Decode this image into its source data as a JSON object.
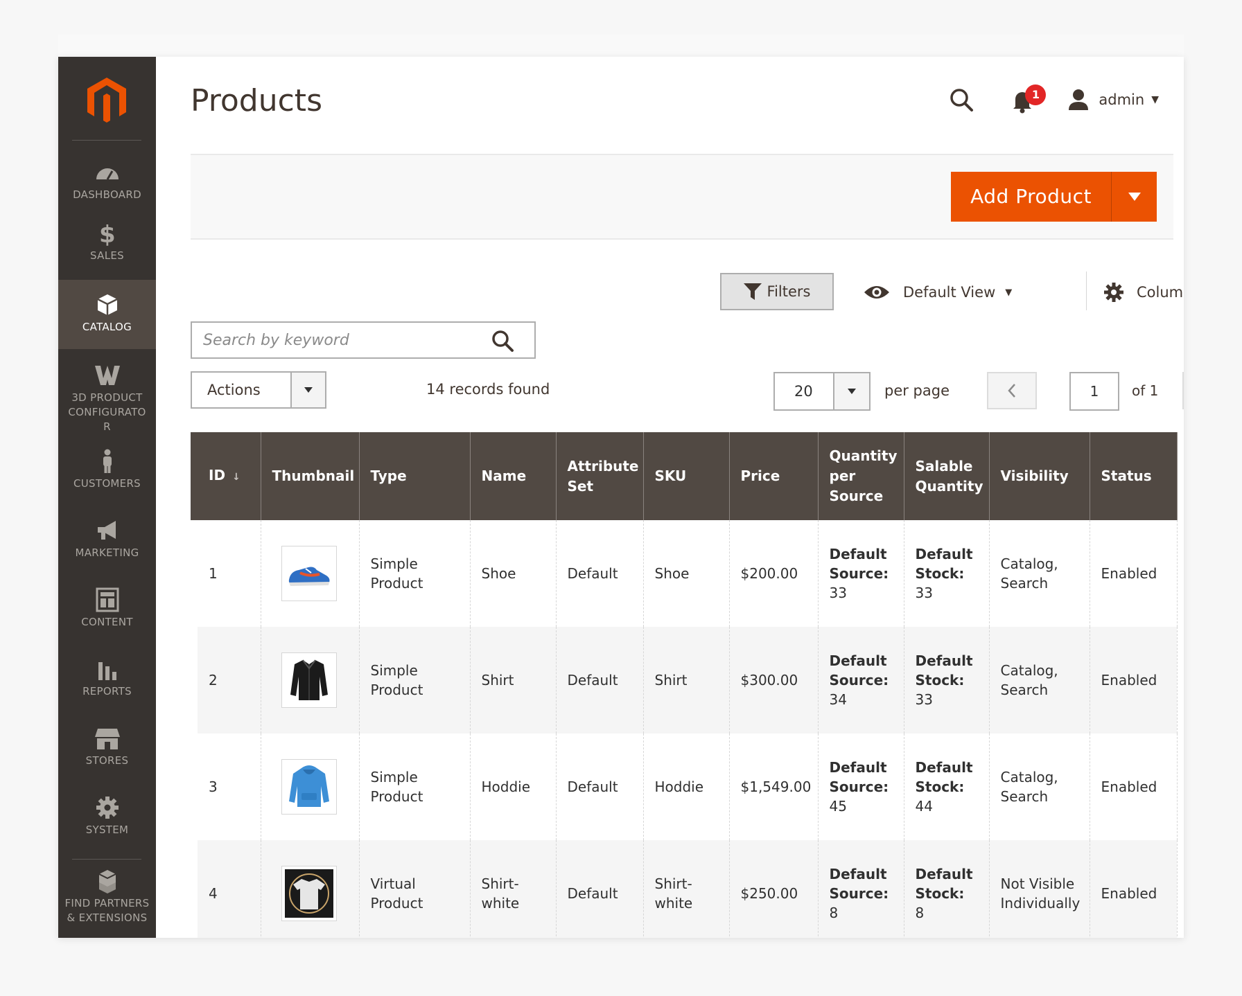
{
  "sidebar": {
    "items": [
      {
        "label": "DASHBOARD",
        "icon": "dashboard-gauge-icon"
      },
      {
        "label": "SALES",
        "icon": "dollar-icon"
      },
      {
        "label": "CATALOG",
        "icon": "box-icon",
        "active": true
      },
      {
        "label": "3D PRODUCT CONFIGURATO R",
        "icon": "w-logo-icon"
      },
      {
        "label": "CUSTOMERS",
        "icon": "person-icon"
      },
      {
        "label": "MARKETING",
        "icon": "megaphone-icon"
      },
      {
        "label": "CONTENT",
        "icon": "layout-icon"
      },
      {
        "label": "REPORTS",
        "icon": "bar-chart-icon"
      },
      {
        "label": "STORES",
        "icon": "storefront-icon"
      },
      {
        "label": "SYSTEM",
        "icon": "gear-icon"
      },
      {
        "label": "FIND PARTNERS & EXTENSIONS",
        "icon": "cubes-icon"
      }
    ]
  },
  "header": {
    "title": "Products",
    "notification_count": "1",
    "user_name": "admin"
  },
  "actions": {
    "add_product_label": "Add Product"
  },
  "toolbar": {
    "filters_label": "Filters",
    "view_label": "Default View",
    "columns_label": "Columns",
    "search_placeholder": "Search by keyword",
    "actions_label": "Actions",
    "records_found": "14 records found",
    "per_page_value": "20",
    "per_page_label": "per page",
    "current_page": "1",
    "page_of": "of 1"
  },
  "colors": {
    "accent": "#eb5202",
    "sidebar_bg": "#373330",
    "header_bg": "#514943"
  },
  "table": {
    "columns": [
      "ID",
      "Thumbnail",
      "Type",
      "Name",
      "Attribute Set",
      "SKU",
      "Price",
      "Quantity per Source",
      "Salable Quantity",
      "Visibility",
      "Status"
    ],
    "rows": [
      {
        "id": "1",
        "thumb": "shoe",
        "type": "Simple Product",
        "name": "Shoe",
        "attribute_set": "Default",
        "sku": "Shoe",
        "price": "$200.00",
        "qty_label": "Default Source:",
        "qty_value": "33",
        "salable_label": "Default Stock:",
        "salable_value": "33",
        "visibility": "Catalog, Search",
        "status": "Enabled"
      },
      {
        "id": "2",
        "thumb": "shirt",
        "type": "Simple Product",
        "name": "Shirt",
        "attribute_set": "Default",
        "sku": "Shirt",
        "price": "$300.00",
        "qty_label": "Default Source:",
        "qty_value": "34",
        "salable_label": "Default Stock:",
        "salable_value": "33",
        "visibility": "Catalog, Search",
        "status": "Enabled"
      },
      {
        "id": "3",
        "thumb": "hoodie",
        "type": "Simple Product",
        "name": "Hoddie",
        "attribute_set": "Default",
        "sku": "Hoddie",
        "price": "$1,549.00",
        "qty_label": "Default Source:",
        "qty_value": "45",
        "salable_label": "Default Stock:",
        "salable_value": "44",
        "visibility": "Catalog, Search",
        "status": "Enabled"
      },
      {
        "id": "4",
        "thumb": "tshirt",
        "type": "Virtual Product",
        "name": "Shirt-white",
        "attribute_set": "Default",
        "sku": "Shirt-white",
        "price": "$250.00",
        "qty_label": "Default Source:",
        "qty_value": "8",
        "salable_label": "Default Stock:",
        "salable_value": "8",
        "visibility": "Not Visible Individually",
        "status": "Enabled"
      }
    ]
  }
}
